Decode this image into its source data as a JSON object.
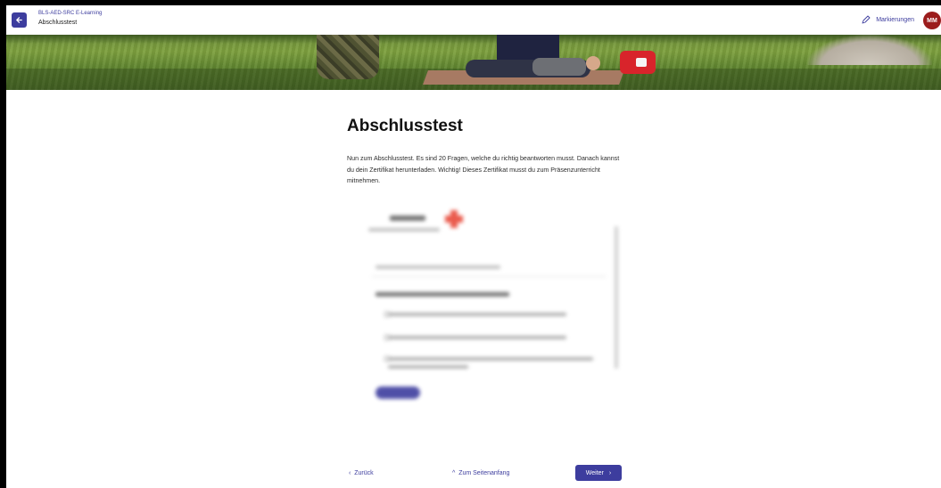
{
  "header": {
    "course_name": "BLS-AED-SRC E-Learning",
    "page_title": "Abschlusstest",
    "markings_label": "Markierungen",
    "avatar_initials": "MM"
  },
  "main": {
    "heading": "Abschlusstest",
    "intro": "Nun zum Abschlusstest. Es sind 20 Fragen, welche du richtig beantworten musst. Danach kannst du dein Zertifikat herunterladen. Wichtig! Dieses Zertifikat musst du zum Präsenzunterricht mitnehmen."
  },
  "footer": {
    "prev_label": "Zurück",
    "top_label": "Zum Seitenanfang",
    "next_label": "Weiter"
  },
  "colors": {
    "accent": "#3d3d9e",
    "avatar": "#9b1c1c"
  }
}
